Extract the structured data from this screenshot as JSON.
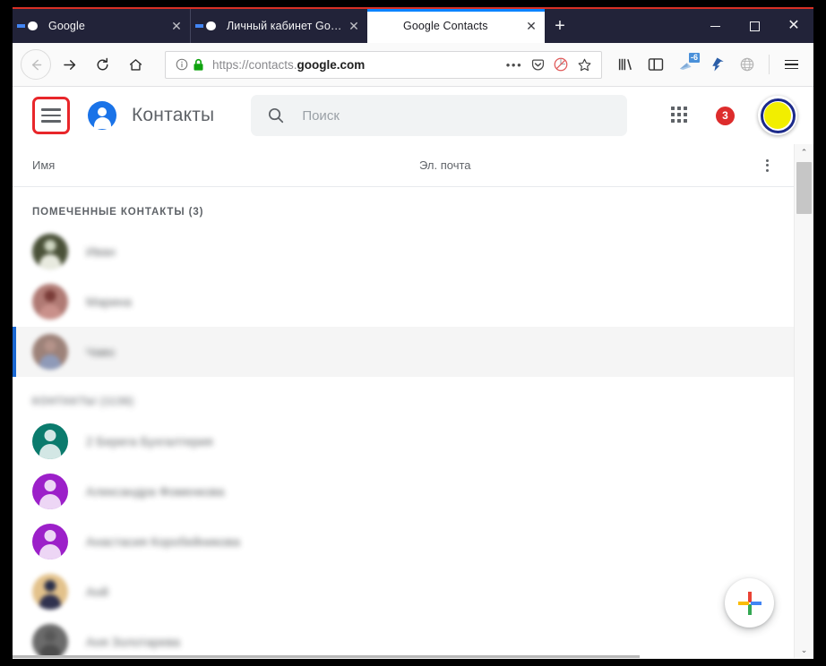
{
  "browser": {
    "tabs": [
      {
        "title": "Google",
        "favicon": "google-g-icon",
        "active": false
      },
      {
        "title": "Личный кабинет Google",
        "favicon": "google-g-icon",
        "active": false
      },
      {
        "title": "Google Contacts",
        "favicon": "google-contacts-icon",
        "active": true
      }
    ],
    "new_tab_label": "+",
    "window_controls": {
      "minimize": "—",
      "maximize": "☐",
      "close": "✕"
    },
    "nav": {
      "back": "back-arrow",
      "forward": "forward-arrow",
      "reload": "reload",
      "home": "home"
    },
    "url": {
      "prefix": "https://contacts.",
      "domain": "google.com",
      "full": "https://contacts.google.com",
      "info_icon": "ⓘ",
      "lock_icon": "padlock-secure",
      "page_actions": "…",
      "pocket_icon": "pocket-save",
      "tracking_icon": "tracking-protection-disabled",
      "bookmark_icon": "star-bookmark"
    },
    "toolbar_icons": [
      {
        "name": "library-icon"
      },
      {
        "name": "sidebar-icon"
      },
      {
        "name": "sync-icon",
        "badge": "-6"
      },
      {
        "name": "account-icon"
      },
      {
        "name": "container-icon"
      },
      {
        "name": "app-menu-icon"
      }
    ]
  },
  "app": {
    "menu_button": "menu-hamburger",
    "logo": "contacts-logo",
    "title": "Контакты",
    "search": {
      "placeholder": "Поиск",
      "value": "",
      "icon": "search-icon"
    },
    "apps_launcher": "google-apps-grid",
    "notification_count": "3",
    "avatar": {
      "ring_color": "#1c2a8a",
      "fill_color": "#f2ee00"
    },
    "columns": {
      "name": "Имя",
      "email": "Эл. почта",
      "more": "more-options"
    },
    "sections": [
      {
        "label": "ПОМЕЧЕННЫЕ КОНТАКТЫ (3)",
        "blurred": false,
        "contacts": [
          {
            "name": "Иван",
            "avatar_type": "photo",
            "avatar_color": "#4a5138",
            "blurred": true,
            "selected": false
          },
          {
            "name": "Марина",
            "avatar_type": "photo",
            "avatar_color": "#b07a74",
            "blurred": true,
            "selected": false
          },
          {
            "name": "Чаво",
            "avatar_type": "photo",
            "avatar_color": "#9d8279",
            "blurred": true,
            "selected": true
          }
        ]
      },
      {
        "label": "КОНТАКТЫ (1136)",
        "blurred": true,
        "contacts": [
          {
            "name": "2 Берега Бухгалтерия",
            "avatar_type": "initial",
            "avatar_color": "#0b7b6d",
            "blurred": true,
            "selected": false
          },
          {
            "name": "Александра Фоменкова",
            "avatar_type": "initial",
            "avatar_color": "#9c20c9",
            "blurred": true,
            "selected": false
          },
          {
            "name": "Анастасия Коробейникова",
            "avatar_type": "initial",
            "avatar_color": "#9c20c9",
            "blurred": true,
            "selected": false
          },
          {
            "name": "Анй",
            "avatar_type": "photo",
            "avatar_color": "#e3c28b",
            "blurred": true,
            "selected": false
          },
          {
            "name": "Аня Золотарева",
            "avatar_type": "photo",
            "avatar_color": "#6b6b6b",
            "blurred": true,
            "selected": false
          }
        ]
      }
    ],
    "fab": {
      "name": "create-contact-button",
      "icon": "google-plus-icon"
    },
    "scrollbar": {
      "up_arrow": "⌃",
      "down_arrow": "⌄"
    }
  }
}
